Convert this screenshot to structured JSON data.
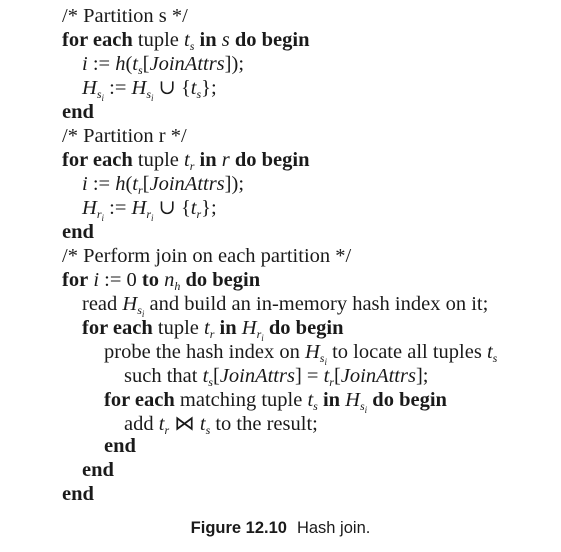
{
  "algorithm": {
    "comment_partition_s": "/* Partition s */",
    "comment_partition_r": "/* Partition r */",
    "comment_perform_join": "/* Perform join on each partition */",
    "kw_for_each": "for each",
    "kw_for": "for",
    "kw_in": "in",
    "kw_do_begin": "do begin",
    "kw_end": "end",
    "kw_to": "to",
    "word_tuple": "tuple",
    "rel_s": "s",
    "rel_r": "r",
    "var_i": "i",
    "assign": ":=",
    "func_h": "h",
    "join_attrs": "JoinAttrs",
    "union": "∪",
    "H": "H",
    "t": "t",
    "zero": "0",
    "n": "n",
    "sub_h": "h",
    "sub_s": "s",
    "sub_r": "r",
    "sub_i": "i",
    "read_text": "read",
    "build_text": "and build an in-memory hash index on it;",
    "probe_text": "probe the hash index on",
    "locate_text": "to locate all tuples",
    "such_that_text": "such that",
    "eq": "=",
    "matching_text": "matching tuple",
    "add_text": "add",
    "join_symbol": "⋈",
    "result_text": "to the result;"
  },
  "caption": {
    "number": "Figure 12.10",
    "title": "Hash join."
  }
}
